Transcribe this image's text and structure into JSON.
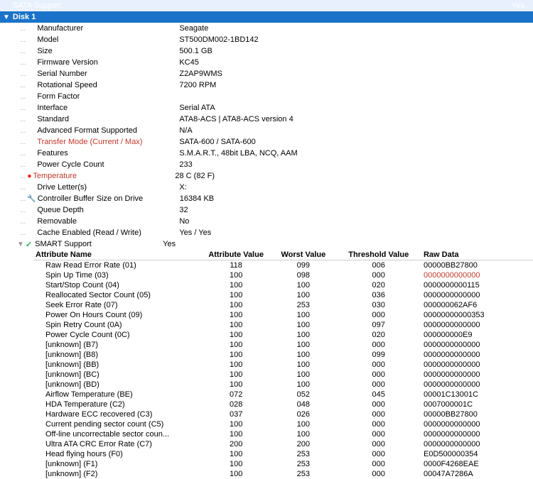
{
  "disk": {
    "header": "Disk 1",
    "top_label": "SATA Support",
    "top_value": "Yes"
  },
  "properties": [
    {
      "id": "manufacturer",
      "label": "Manufacturer",
      "value": "Seagate",
      "indent": 2,
      "red": false
    },
    {
      "id": "model",
      "label": "Model",
      "value": "ST500DM002-1BD142",
      "indent": 2,
      "red": false
    },
    {
      "id": "size",
      "label": "Size",
      "value": "500.1 GB",
      "indent": 2,
      "red": false
    },
    {
      "id": "firmware",
      "label": "Firmware Version",
      "value": "KC45",
      "indent": 2,
      "red": false
    },
    {
      "id": "serial",
      "label": "Serial Number",
      "value": "Z2AP9WMS",
      "indent": 2,
      "red": false
    },
    {
      "id": "rotation",
      "label": "Rotational Speed",
      "value": "7200 RPM",
      "indent": 2,
      "red": false
    },
    {
      "id": "form",
      "label": "Form Factor",
      "value": "",
      "indent": 2,
      "red": false
    },
    {
      "id": "interface",
      "label": "Interface",
      "value": "Serial ATA",
      "indent": 2,
      "red": false
    },
    {
      "id": "standard",
      "label": "Standard",
      "value": "ATA8-ACS | ATA8-ACS version 4",
      "indent": 2,
      "red": false
    },
    {
      "id": "adv_format",
      "label": "Advanced Format Supported",
      "value": "N/A",
      "indent": 2,
      "red": false
    },
    {
      "id": "transfer",
      "label": "Transfer Mode (Current / Max)",
      "value": "SATA-600 / SATA-600",
      "indent": 2,
      "red": true
    },
    {
      "id": "features",
      "label": "Features",
      "value": "S.M.A.R.T., 48bit LBA, NCQ, AAM",
      "indent": 2,
      "red": false
    },
    {
      "id": "power_cycle",
      "label": "Power Cycle Count",
      "value": "233",
      "indent": 2,
      "red": false
    },
    {
      "id": "temperature",
      "label": "Temperature",
      "value": "28 C (82 F)",
      "indent": 2,
      "red": true,
      "has_icon": true,
      "icon": "🔴"
    },
    {
      "id": "drive_letter",
      "label": "Drive Letter(s)",
      "value": "X:",
      "indent": 2,
      "red": false
    },
    {
      "id": "ctrl_buffer",
      "label": "Controller Buffer Size on Drive",
      "value": "16384 KB",
      "indent": 2,
      "red": false,
      "has_wrench": true
    },
    {
      "id": "queue_depth",
      "label": "Queue Depth",
      "value": "32",
      "indent": 2,
      "red": false
    },
    {
      "id": "removable",
      "label": "Removable",
      "value": "No",
      "indent": 2,
      "red": false
    },
    {
      "id": "cache_enabled",
      "label": "Cache Enabled (Read / Write)",
      "value": "Yes / Yes",
      "indent": 2,
      "red": false
    }
  ],
  "smart_section": {
    "label": "SMART Support",
    "value": "Yes",
    "has_check": true,
    "columns": [
      "Attribute Name",
      "Attribute Value",
      "Worst Value",
      "Threshold Value",
      "Raw Data"
    ],
    "rows": [
      {
        "attr": "Raw Read Error Rate (01)",
        "attrval": "118",
        "worst": "099",
        "thresh": "006",
        "raw": "00000BB27800"
      },
      {
        "attr": "Spin Up Time (03)",
        "attrval": "100",
        "worst": "098",
        "thresh": "000",
        "raw": "0000000000000",
        "raw_red": true
      },
      {
        "attr": "Start/Stop Count (04)",
        "attrval": "100",
        "worst": "100",
        "thresh": "020",
        "raw": "0000000000115"
      },
      {
        "attr": "Reallocated Sector Count (05)",
        "attrval": "100",
        "worst": "100",
        "thresh": "036",
        "raw": "0000000000000"
      },
      {
        "attr": "Seek Error Rate (07)",
        "attrval": "100",
        "worst": "253",
        "thresh": "030",
        "raw": "000000062AF6"
      },
      {
        "attr": "Power On Hours Count (09)",
        "attrval": "100",
        "worst": "100",
        "thresh": "000",
        "raw": "00000000000353"
      },
      {
        "attr": "Spin Retry Count (0A)",
        "attrval": "100",
        "worst": "100",
        "thresh": "097",
        "raw": "0000000000000"
      },
      {
        "attr": "Power Cycle Count (0C)",
        "attrval": "100",
        "worst": "100",
        "thresh": "020",
        "raw": "000000000E9"
      },
      {
        "attr": "[unknown] (B7)",
        "attrval": "100",
        "worst": "100",
        "thresh": "000",
        "raw": "0000000000000"
      },
      {
        "attr": "[unknown] (B8)",
        "attrval": "100",
        "worst": "100",
        "thresh": "099",
        "raw": "0000000000000"
      },
      {
        "attr": "[unknown] (BB)",
        "attrval": "100",
        "worst": "100",
        "thresh": "000",
        "raw": "0000000000000"
      },
      {
        "attr": "[unknown] (BC)",
        "attrval": "100",
        "worst": "100",
        "thresh": "000",
        "raw": "0000000000000"
      },
      {
        "attr": "[unknown] (BD)",
        "attrval": "100",
        "worst": "100",
        "thresh": "000",
        "raw": "0000000000000"
      },
      {
        "attr": "Airflow Temperature (BE)",
        "attrval": "072",
        "worst": "052",
        "thresh": "045",
        "raw": "00001C13001C"
      },
      {
        "attr": "HDA Temperature (C2)",
        "attrval": "028",
        "worst": "048",
        "thresh": "000",
        "raw": "0007000001C"
      },
      {
        "attr": "Hardware ECC recovered (C3)",
        "attrval": "037",
        "worst": "026",
        "thresh": "000",
        "raw": "00000BB27800"
      },
      {
        "attr": "Current pending sector count (C5)",
        "attrval": "100",
        "worst": "100",
        "thresh": "000",
        "raw": "0000000000000"
      },
      {
        "attr": "Off-line uncorrectable sector coun...",
        "attrval": "100",
        "worst": "100",
        "thresh": "000",
        "raw": "0000000000000"
      },
      {
        "attr": "Ultra ATA CRC Error Rate (C7)",
        "attrval": "200",
        "worst": "200",
        "thresh": "000",
        "raw": "0000000000000"
      },
      {
        "attr": "Head flying hours (F0)",
        "attrval": "100",
        "worst": "253",
        "thresh": "000",
        "raw": "E0D500000354"
      },
      {
        "attr": "[unknown] (F1)",
        "attrval": "100",
        "worst": "253",
        "thresh": "000",
        "raw": "0000F4268EAE"
      },
      {
        "attr": "[unknown] (F2)",
        "attrval": "100",
        "worst": "253",
        "thresh": "000",
        "raw": "00047A7286A"
      }
    ]
  }
}
